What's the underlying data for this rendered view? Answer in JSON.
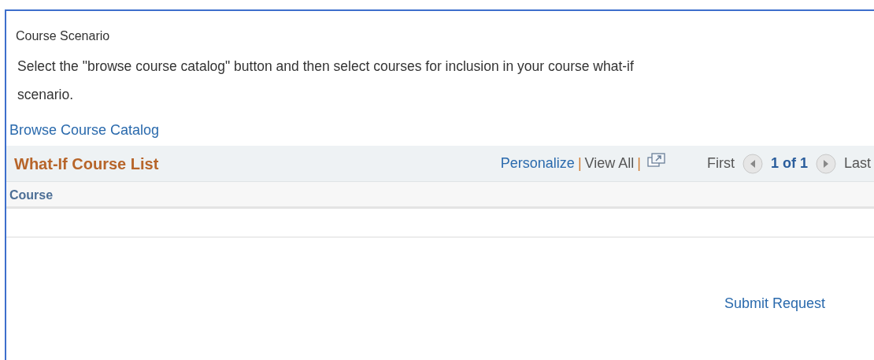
{
  "section_title": "Course Scenario",
  "instructions": "Select the \"browse course catalog\" button and then select courses for inclusion in your course what-if scenario.",
  "browse_link": "Browse Course Catalog",
  "grid": {
    "title": "What-If Course List",
    "toolbar": {
      "personalize": "Personalize",
      "separator_1": "|",
      "view_all": "View All",
      "separator_2": "|",
      "first": "First",
      "position": "1 of 1",
      "last": "Last"
    },
    "columns": [
      "Course"
    ]
  },
  "submit": "Submit Request"
}
